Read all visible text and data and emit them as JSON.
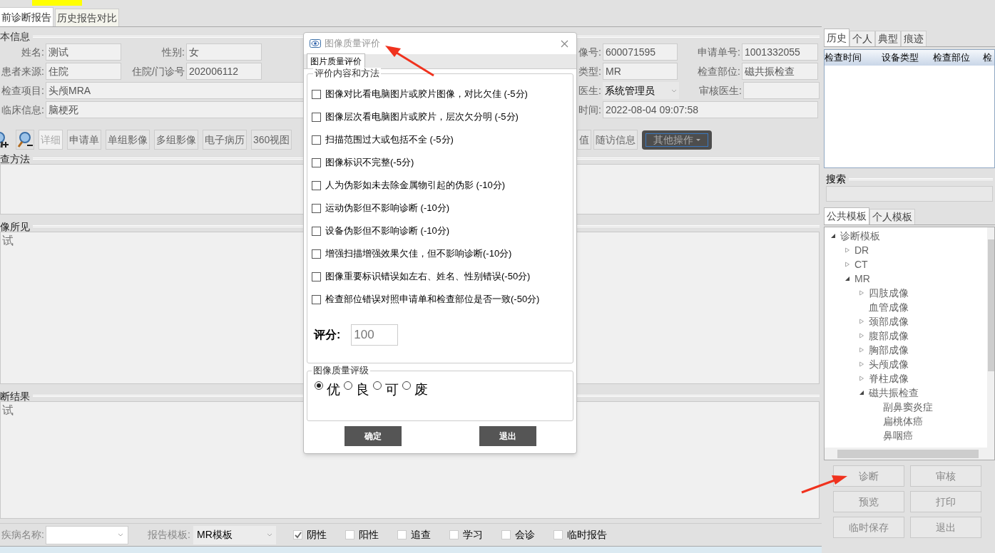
{
  "report_tabs": [
    {
      "label": "前诊断报告",
      "selected": true
    },
    {
      "label": "历史报告对比",
      "selected": false
    }
  ],
  "basic_info": {
    "legend": "本信息",
    "rows": [
      {
        "left": [
          {
            "label": "姓名:",
            "value": "测试"
          },
          {
            "label": "性别:",
            "value": "女"
          }
        ],
        "right": [
          {
            "label": "像号:",
            "value": "600071595"
          },
          {
            "label": "申请单号:",
            "value": "1001332055"
          }
        ]
      },
      {
        "left": [
          {
            "label": "患者来源:",
            "value": "住院"
          },
          {
            "label": "住院/门诊号",
            "value": "202006112"
          }
        ],
        "right": [
          {
            "label": "类型:",
            "value": "MR"
          },
          {
            "label": "检查部位:",
            "value": "磁共振检查"
          }
        ]
      },
      {
        "left": [
          {
            "label": "检查项目:",
            "value": "头颅MRA"
          }
        ],
        "right": [
          {
            "label": "医生:",
            "value": "系统管理员",
            "kind": "select"
          },
          {
            "label": "审核医生:"
          }
        ]
      },
      {
        "left": [
          {
            "label": "临床信息:",
            "value": "脑梗死"
          }
        ],
        "right": [
          {
            "label": "时间:",
            "value": "2022-08-04 09:07:58"
          }
        ]
      }
    ]
  },
  "toolbar": {
    "buttons": [
      {
        "label": "详细",
        "disabled": true
      },
      {
        "label": "申请单",
        "disabled": false
      },
      {
        "label": "单组影像",
        "disabled": false
      },
      {
        "label": "多组影像",
        "disabled": false
      },
      {
        "label": "电子病历",
        "disabled": false
      },
      {
        "label": "360视图",
        "disabled": false
      }
    ],
    "right_buttons": [
      {
        "label": "值"
      },
      {
        "label": "随访信息"
      }
    ],
    "other_operations": "其他操作"
  },
  "sections": [
    {
      "title": "查方法"
    },
    {
      "title": "像所见",
      "text": "试"
    },
    {
      "title": "断结果",
      "text": "试"
    }
  ],
  "bottom_bar": {
    "disease_name": {
      "label": "疾病名称:"
    },
    "report_template": {
      "label": "报告模板:",
      "value": "MR模板"
    },
    "checks": [
      {
        "label": "阴性",
        "checked": true
      },
      {
        "label": "阳性",
        "checked": false
      },
      {
        "label": "追查",
        "checked": false
      },
      {
        "label": "学习",
        "checked": false
      },
      {
        "label": "会诊",
        "checked": false
      },
      {
        "label": "临时报告",
        "checked": false
      }
    ]
  },
  "history_tabs": [
    {
      "label": "历史",
      "selected": true
    },
    {
      "label": "个人",
      "selected": false
    },
    {
      "label": "典型",
      "selected": false
    },
    {
      "label": "痕迹",
      "selected": false
    }
  ],
  "history_table": {
    "columns": [
      "检查时间",
      "设备类型",
      "检查部位",
      "检"
    ]
  },
  "search": {
    "legend": "搜索"
  },
  "template_tabs": [
    {
      "label": "公共模板",
      "selected": true
    },
    {
      "label": "个人模板",
      "selected": false
    }
  ],
  "template_tree": [
    {
      "label": "诊断模板",
      "expanded": true,
      "children": [
        {
          "label": "DR",
          "expanded": false
        },
        {
          "label": "CT",
          "expanded": false
        },
        {
          "label": "MR",
          "expanded": true,
          "children": [
            {
              "label": "四肢成像",
              "expanded": false
            },
            {
              "label": "血管成像"
            },
            {
              "label": "颈部成像",
              "expanded": false
            },
            {
              "label": "腹部成像",
              "expanded": false
            },
            {
              "label": "胸部成像",
              "expanded": false
            },
            {
              "label": "头颅成像",
              "expanded": false
            },
            {
              "label": "脊柱成像",
              "expanded": false
            },
            {
              "label": "磁共振检查",
              "expanded": true,
              "children": [
                {
                  "label": "副鼻窦炎症"
                },
                {
                  "label": "扁桃体癌"
                },
                {
                  "label": "鼻咽癌"
                }
              ]
            }
          ]
        }
      ]
    }
  ],
  "action_buttons": [
    "诊断",
    "审核",
    "预览",
    "打印",
    "临时保存",
    "退出"
  ],
  "dialog": {
    "title": "图像质量评价",
    "tab": {
      "label": "图片质量评价",
      "selected": true
    },
    "criteria_legend": "评价内容和方法",
    "criteria": [
      {
        "label": "图像对比看电脑图片或胶片图像，对比欠佳 (-5分)",
        "checked": false
      },
      {
        "label": "图像层次看电脑图片或胶片，层次欠分明 (-5分)",
        "checked": false
      },
      {
        "label": "扫描范围过大或包括不全 (-5分)",
        "checked": false
      },
      {
        "label": "图像标识不完整(-5分)",
        "checked": false
      },
      {
        "label": "人为伪影如未去除金属物引起的伪影 (-10分)",
        "checked": false
      },
      {
        "label": "运动伪影但不影响诊断 (-10分)",
        "checked": false
      },
      {
        "label": "设备伪影但不影响诊断 (-10分)",
        "checked": false
      },
      {
        "label": "增强扫描增强效果欠佳，但不影响诊断(-10分)",
        "checked": false
      },
      {
        "label": "图像重要标识错误如左右、姓名、性别错误(-50分)",
        "checked": false
      },
      {
        "label": "检查部位错误对照申请单和检查部位是否一致(-50分)",
        "checked": false
      }
    ],
    "score": {
      "label": "评分:",
      "value": "100"
    },
    "grade_legend": "图像质量评级",
    "grades": [
      {
        "label": "优",
        "selected": true
      },
      {
        "label": "良",
        "selected": false
      },
      {
        "label": "可",
        "selected": false
      },
      {
        "label": "废",
        "selected": false
      }
    ],
    "buttons": [
      "确定",
      "退出"
    ]
  }
}
